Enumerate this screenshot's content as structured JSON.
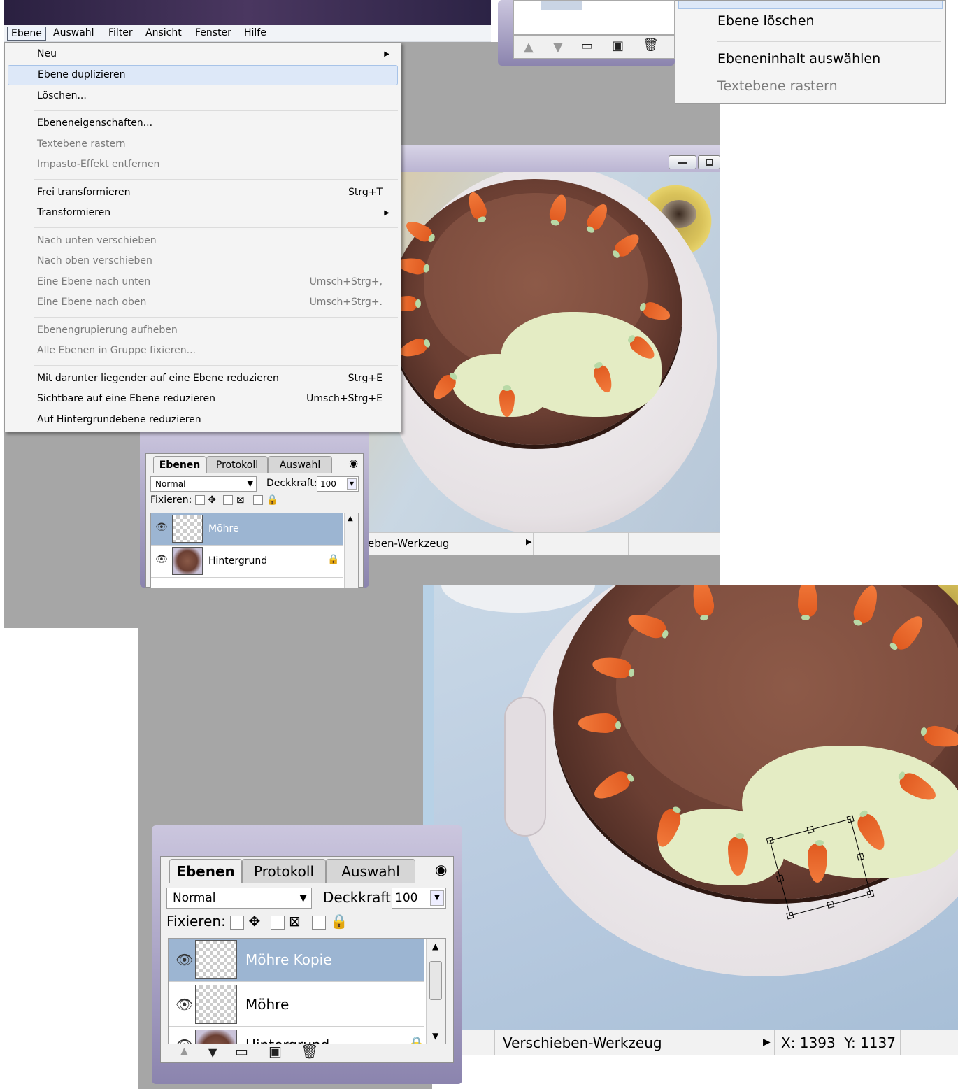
{
  "menubar": {
    "items": [
      "Ebene",
      "Auswahl",
      "Filter",
      "Ansicht",
      "Fenster",
      "Hilfe"
    ]
  },
  "layer_menu": {
    "items": [
      {
        "label": "Neu",
        "shortcut": "",
        "submenu": true,
        "disabled": false
      },
      {
        "label": "Ebene duplizieren",
        "shortcut": "",
        "submenu": false,
        "disabled": false,
        "highlighted": true
      },
      {
        "label": "Löschen...",
        "shortcut": "",
        "submenu": false,
        "disabled": false
      },
      {
        "label": "Ebeneneigenschaften...",
        "shortcut": "",
        "submenu": false,
        "disabled": false
      },
      {
        "label": "Textebene rastern",
        "shortcut": "",
        "submenu": false,
        "disabled": true
      },
      {
        "label": "Impasto-Effekt entfernen",
        "shortcut": "",
        "submenu": false,
        "disabled": true
      },
      {
        "label": "Frei transformieren",
        "shortcut": "Strg+T",
        "submenu": false,
        "disabled": false
      },
      {
        "label": "Transformieren",
        "shortcut": "",
        "submenu": true,
        "disabled": false
      },
      {
        "label": "Nach unten verschieben",
        "shortcut": "",
        "submenu": false,
        "disabled": true
      },
      {
        "label": "Nach oben verschieben",
        "shortcut": "",
        "submenu": false,
        "disabled": true
      },
      {
        "label": "Eine Ebene nach unten",
        "shortcut": "Umsch+Strg+,",
        "submenu": false,
        "disabled": true
      },
      {
        "label": "Eine Ebene nach oben",
        "shortcut": "Umsch+Strg+.",
        "submenu": false,
        "disabled": true
      },
      {
        "label": "Ebenengrupierung aufheben",
        "shortcut": "",
        "submenu": false,
        "disabled": true
      },
      {
        "label": "Alle Ebenen in Gruppe fixieren...",
        "shortcut": "",
        "submenu": false,
        "disabled": true
      },
      {
        "label": "Mit darunter liegender auf eine Ebene reduzieren",
        "shortcut": "Strg+E",
        "submenu": false,
        "disabled": false
      },
      {
        "label": "Sichtbare auf eine Ebene reduzieren",
        "shortcut": "Umsch+Strg+E",
        "submenu": false,
        "disabled": false
      },
      {
        "label": "Auf Hintergrundebene reduzieren",
        "shortcut": "",
        "submenu": false,
        "disabled": false
      }
    ]
  },
  "context_menu": {
    "items": [
      {
        "label": "Ebene löschen",
        "disabled": false
      },
      {
        "label": "Ebeneninhalt auswählen",
        "disabled": false
      },
      {
        "label": "Textebene rastern",
        "disabled": true
      }
    ]
  },
  "layers_panel_small": {
    "tabs": [
      "Ebenen",
      "Protokoll",
      "Auswahl"
    ],
    "blend_mode": "Normal",
    "opacity_label": "Deckkraft:",
    "opacity_value": "100",
    "lock_label": "Fixieren:",
    "layers": [
      {
        "name": "Möhre",
        "selected": true,
        "locked": false
      },
      {
        "name": "Hintergrund",
        "selected": false,
        "locked": true
      }
    ]
  },
  "status_small": {
    "tool": "eben-Werkzeug"
  },
  "layers_panel_large": {
    "tabs": [
      "Ebenen",
      "Protokoll",
      "Auswahl"
    ],
    "blend_mode": "Normal",
    "opacity_label": "Deckkraft:",
    "opacity_value": "100",
    "lock_label": "Fixieren:",
    "layers": [
      {
        "name": "Möhre Kopie",
        "selected": true,
        "locked": false
      },
      {
        "name": "Möhre",
        "selected": false,
        "locked": false
      },
      {
        "name": "Hintergrund",
        "selected": false,
        "locked": true
      }
    ]
  },
  "status_large": {
    "tool": "Verschieben-Werkzeug",
    "coords": "X: 1393  Y: 1137"
  }
}
